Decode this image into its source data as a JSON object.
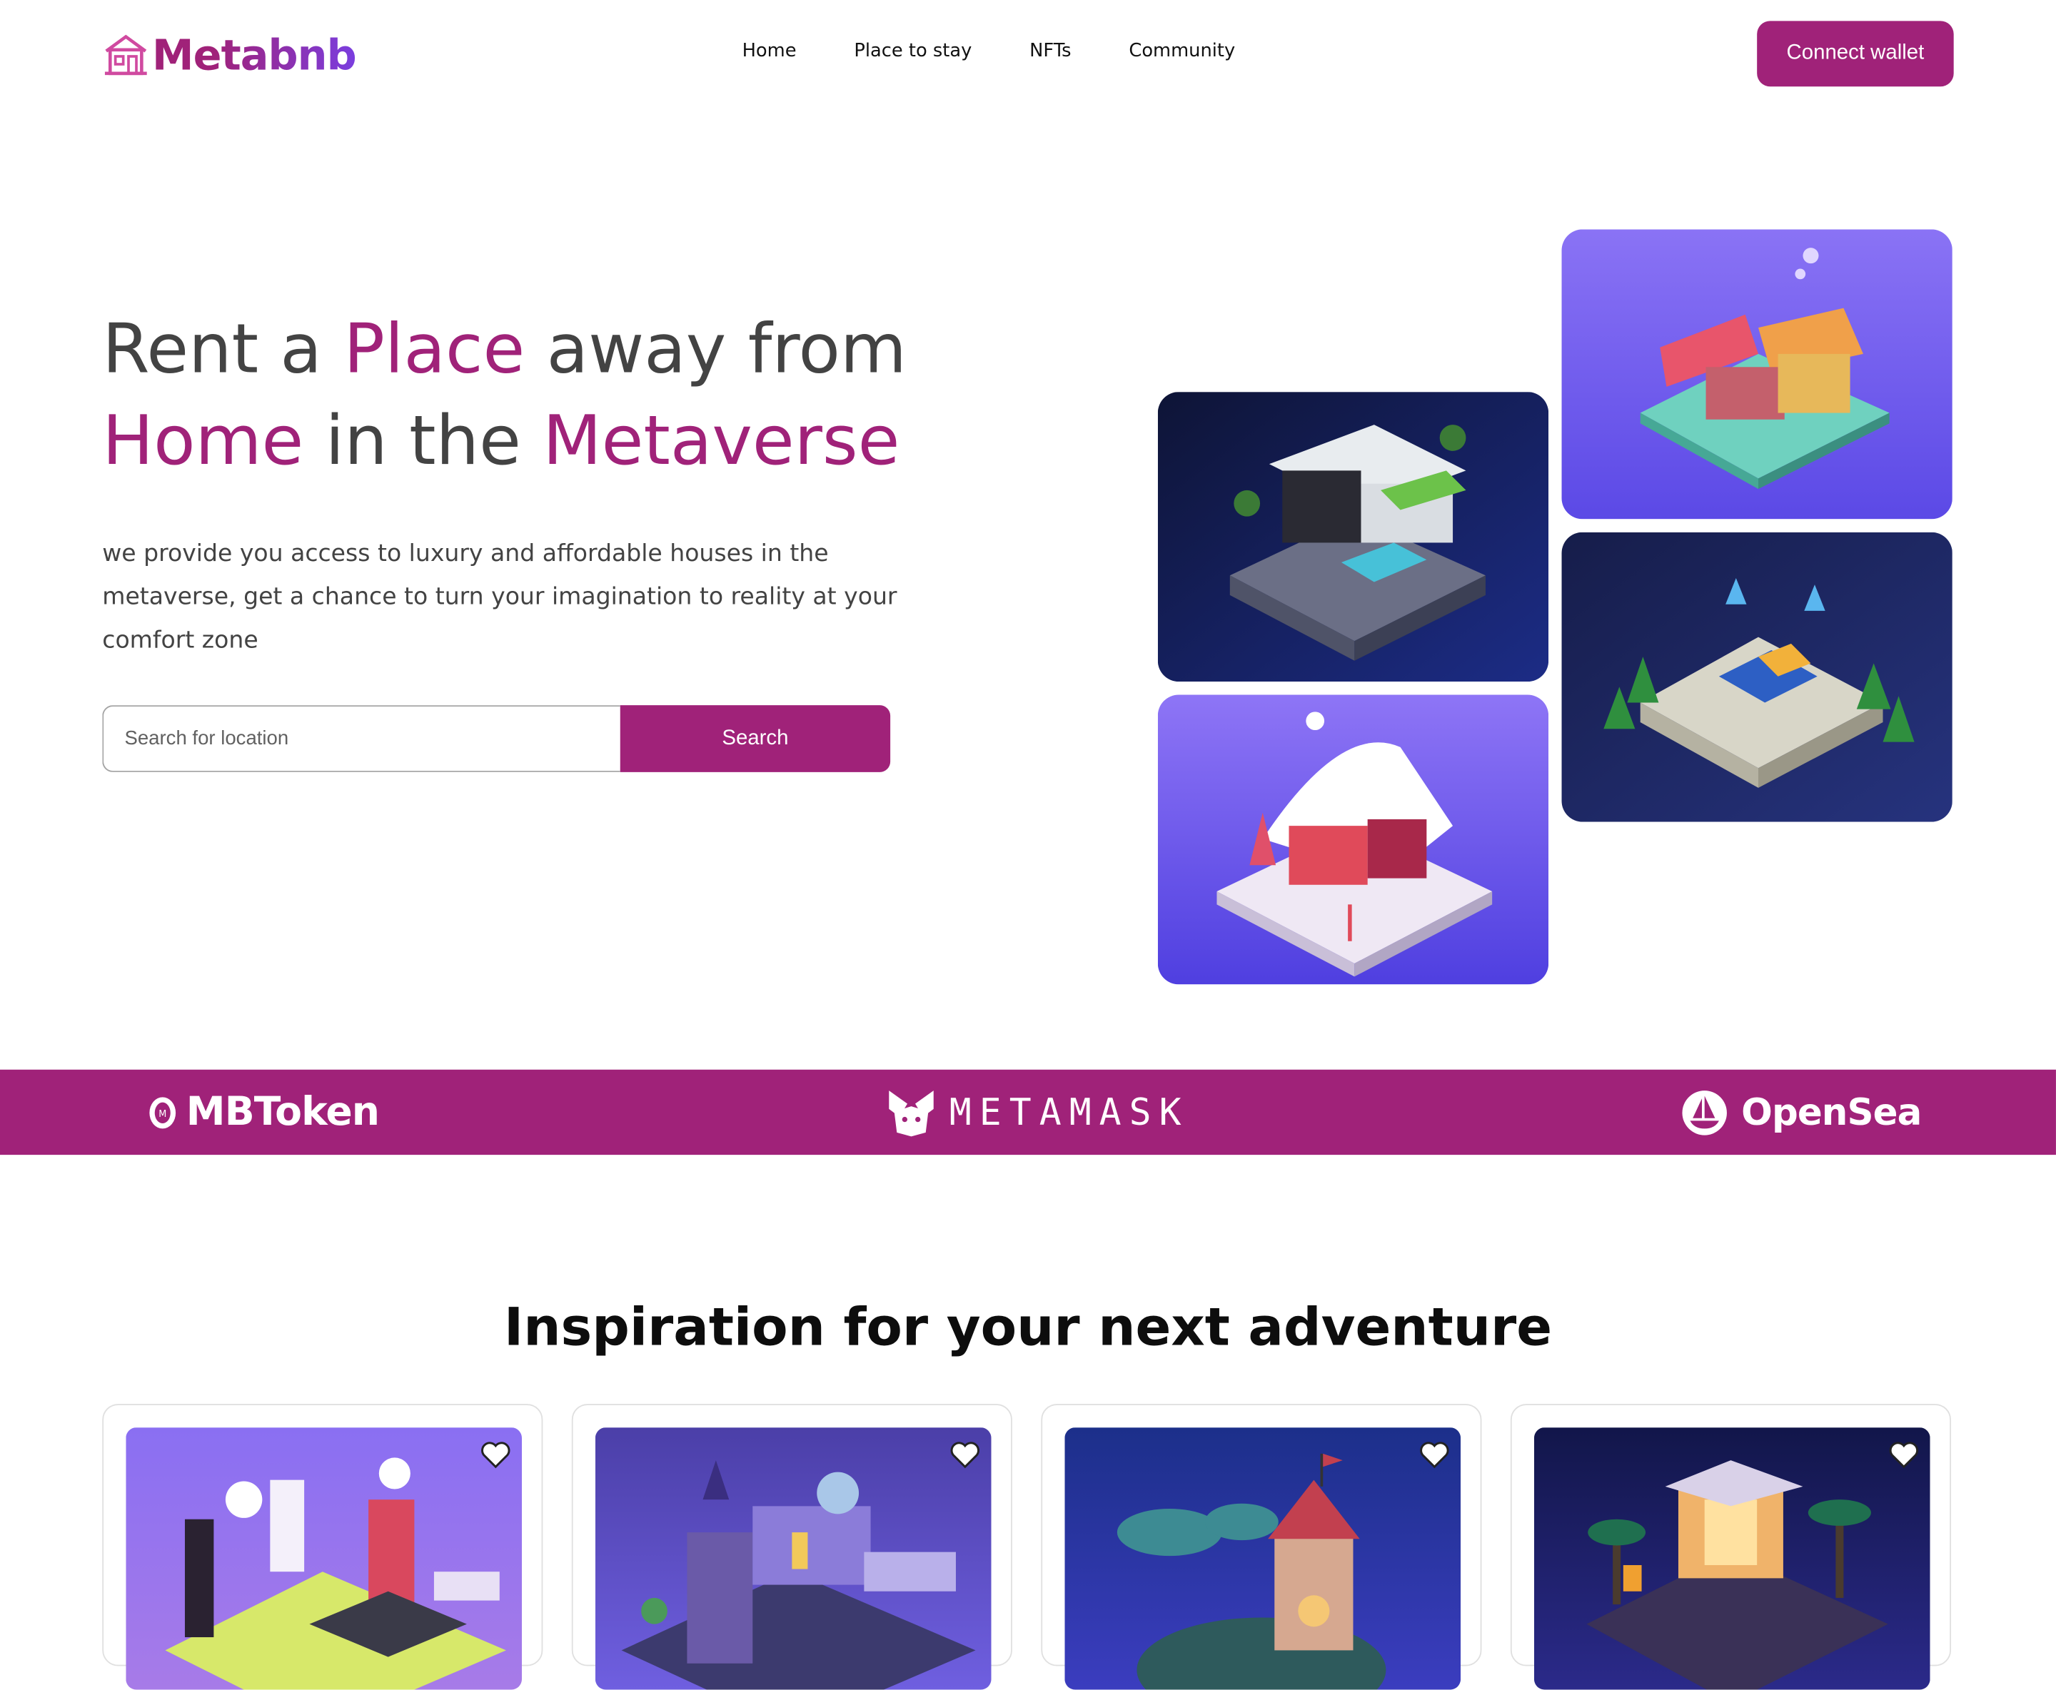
{
  "brand": {
    "name": "Metabnb",
    "icon": "house-icon"
  },
  "nav": [
    {
      "label": "Home"
    },
    {
      "label": "Place to stay"
    },
    {
      "label": "NFTs"
    },
    {
      "label": "Community"
    }
  ],
  "header": {
    "connect_label": "Connect wallet"
  },
  "hero": {
    "title_1": "Rent a ",
    "title_2": "Place",
    "title_3": " away from",
    "title_4": "Home",
    "title_5": " in the ",
    "title_6": "Metaverse",
    "description": "we provide you access to luxury and affordable houses in the metaverse, get a chance to turn your imagination to reality at your comfort zone",
    "search_placeholder": "Search for location",
    "search_label": "Search"
  },
  "partners": [
    {
      "name": "MBToken",
      "icon": "mbtoken-icon"
    },
    {
      "name": "METAMASK",
      "icon": "metamask-fox-icon"
    },
    {
      "name": "OpenSea",
      "icon": "opensea-boat-icon"
    }
  ],
  "inspiration": {
    "title": "Inspiration for your next adventure",
    "cards": [
      {
        "icon": "heart-icon"
      },
      {
        "icon": "heart-icon"
      },
      {
        "icon": "heart-icon"
      },
      {
        "icon": "heart-icon"
      }
    ]
  },
  "colors": {
    "accent": "#a02279",
    "text": "#434343",
    "tile_purple": "#6a5af0",
    "tile_navy": "#1b2460"
  }
}
